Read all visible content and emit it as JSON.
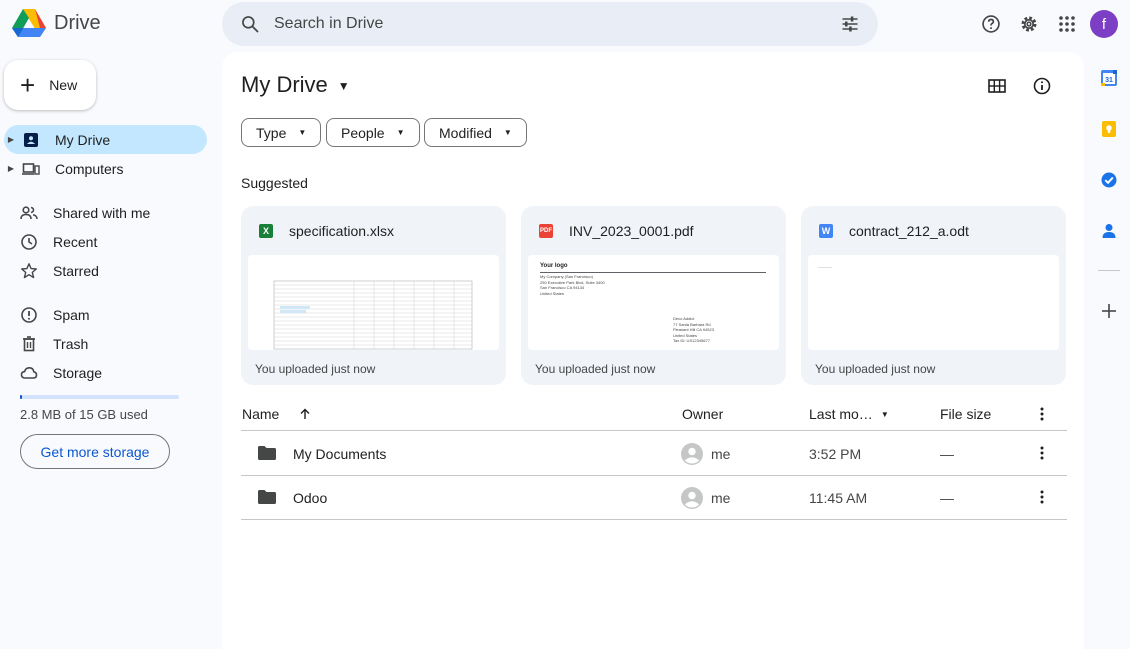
{
  "app": {
    "name": "Drive"
  },
  "search": {
    "placeholder": "Search in Drive"
  },
  "header": {
    "avatar_letter": "f"
  },
  "sidebar": {
    "new_label": "New",
    "items": [
      {
        "label": "My Drive"
      },
      {
        "label": "Computers"
      },
      {
        "label": "Shared with me"
      },
      {
        "label": "Recent"
      },
      {
        "label": "Starred"
      },
      {
        "label": "Spam"
      },
      {
        "label": "Trash"
      },
      {
        "label": "Storage"
      }
    ],
    "storage_used_fraction": 0.0002,
    "storage_text": "2.8 MB of 15 GB used",
    "get_storage_label": "Get more storage"
  },
  "main": {
    "title": "My Drive",
    "filters": [
      "Type",
      "People",
      "Modified"
    ],
    "suggested_label": "Suggested",
    "suggested": [
      {
        "name": "specification.xlsx",
        "badge": "X",
        "color": "#188038",
        "footer": "You uploaded just now"
      },
      {
        "name": "INV_2023_0001.pdf",
        "badge": "PDF",
        "color": "#ea4335",
        "footer": "You uploaded just now"
      },
      {
        "name": "contract_212_a.odt",
        "badge": "W",
        "color": "#4285f4",
        "footer": "You uploaded just now"
      }
    ],
    "pdf_preview": {
      "logo": "Your logo",
      "company_lines": [
        "My Company (San Francisco)",
        "250 Executive Park Blvd, Suite 3400",
        "San Francisco CA 94134",
        "United States"
      ],
      "customer_lines": [
        "Deco Addict",
        "77 Santa Barbara Rd",
        "Pleasant Hill CA 94523",
        "United States",
        "Tax ID: US12345677"
      ]
    },
    "table": {
      "headers": {
        "name": "Name",
        "owner": "Owner",
        "modified": "Last mo…",
        "size": "File size"
      },
      "rows": [
        {
          "name": "My Documents",
          "owner": "me",
          "modified": "3:52 PM",
          "size": "—"
        },
        {
          "name": "Odoo",
          "owner": "me",
          "modified": "11:45 AM",
          "size": "—"
        }
      ]
    }
  }
}
